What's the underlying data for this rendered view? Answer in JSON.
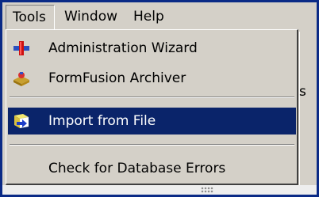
{
  "menubar": {
    "tools": "Tools",
    "window": "Window",
    "help": "Help"
  },
  "backdrop": {
    "partial_text": "s"
  },
  "menu": {
    "items": [
      {
        "label": "Administration Wizard",
        "icon": "administration-wizard-icon"
      },
      {
        "label": "FormFusion Archiver",
        "icon": "archiver-icon"
      },
      {
        "label": "Import from File",
        "icon": "import-file-icon",
        "selected": true
      },
      {
        "label": "Check for Database Errors",
        "icon": ""
      }
    ]
  },
  "colors": {
    "frame": "#0a2a86",
    "menu_face": "#d4d0c8",
    "selection": "#0a246a",
    "selection_text": "#ffffff"
  }
}
